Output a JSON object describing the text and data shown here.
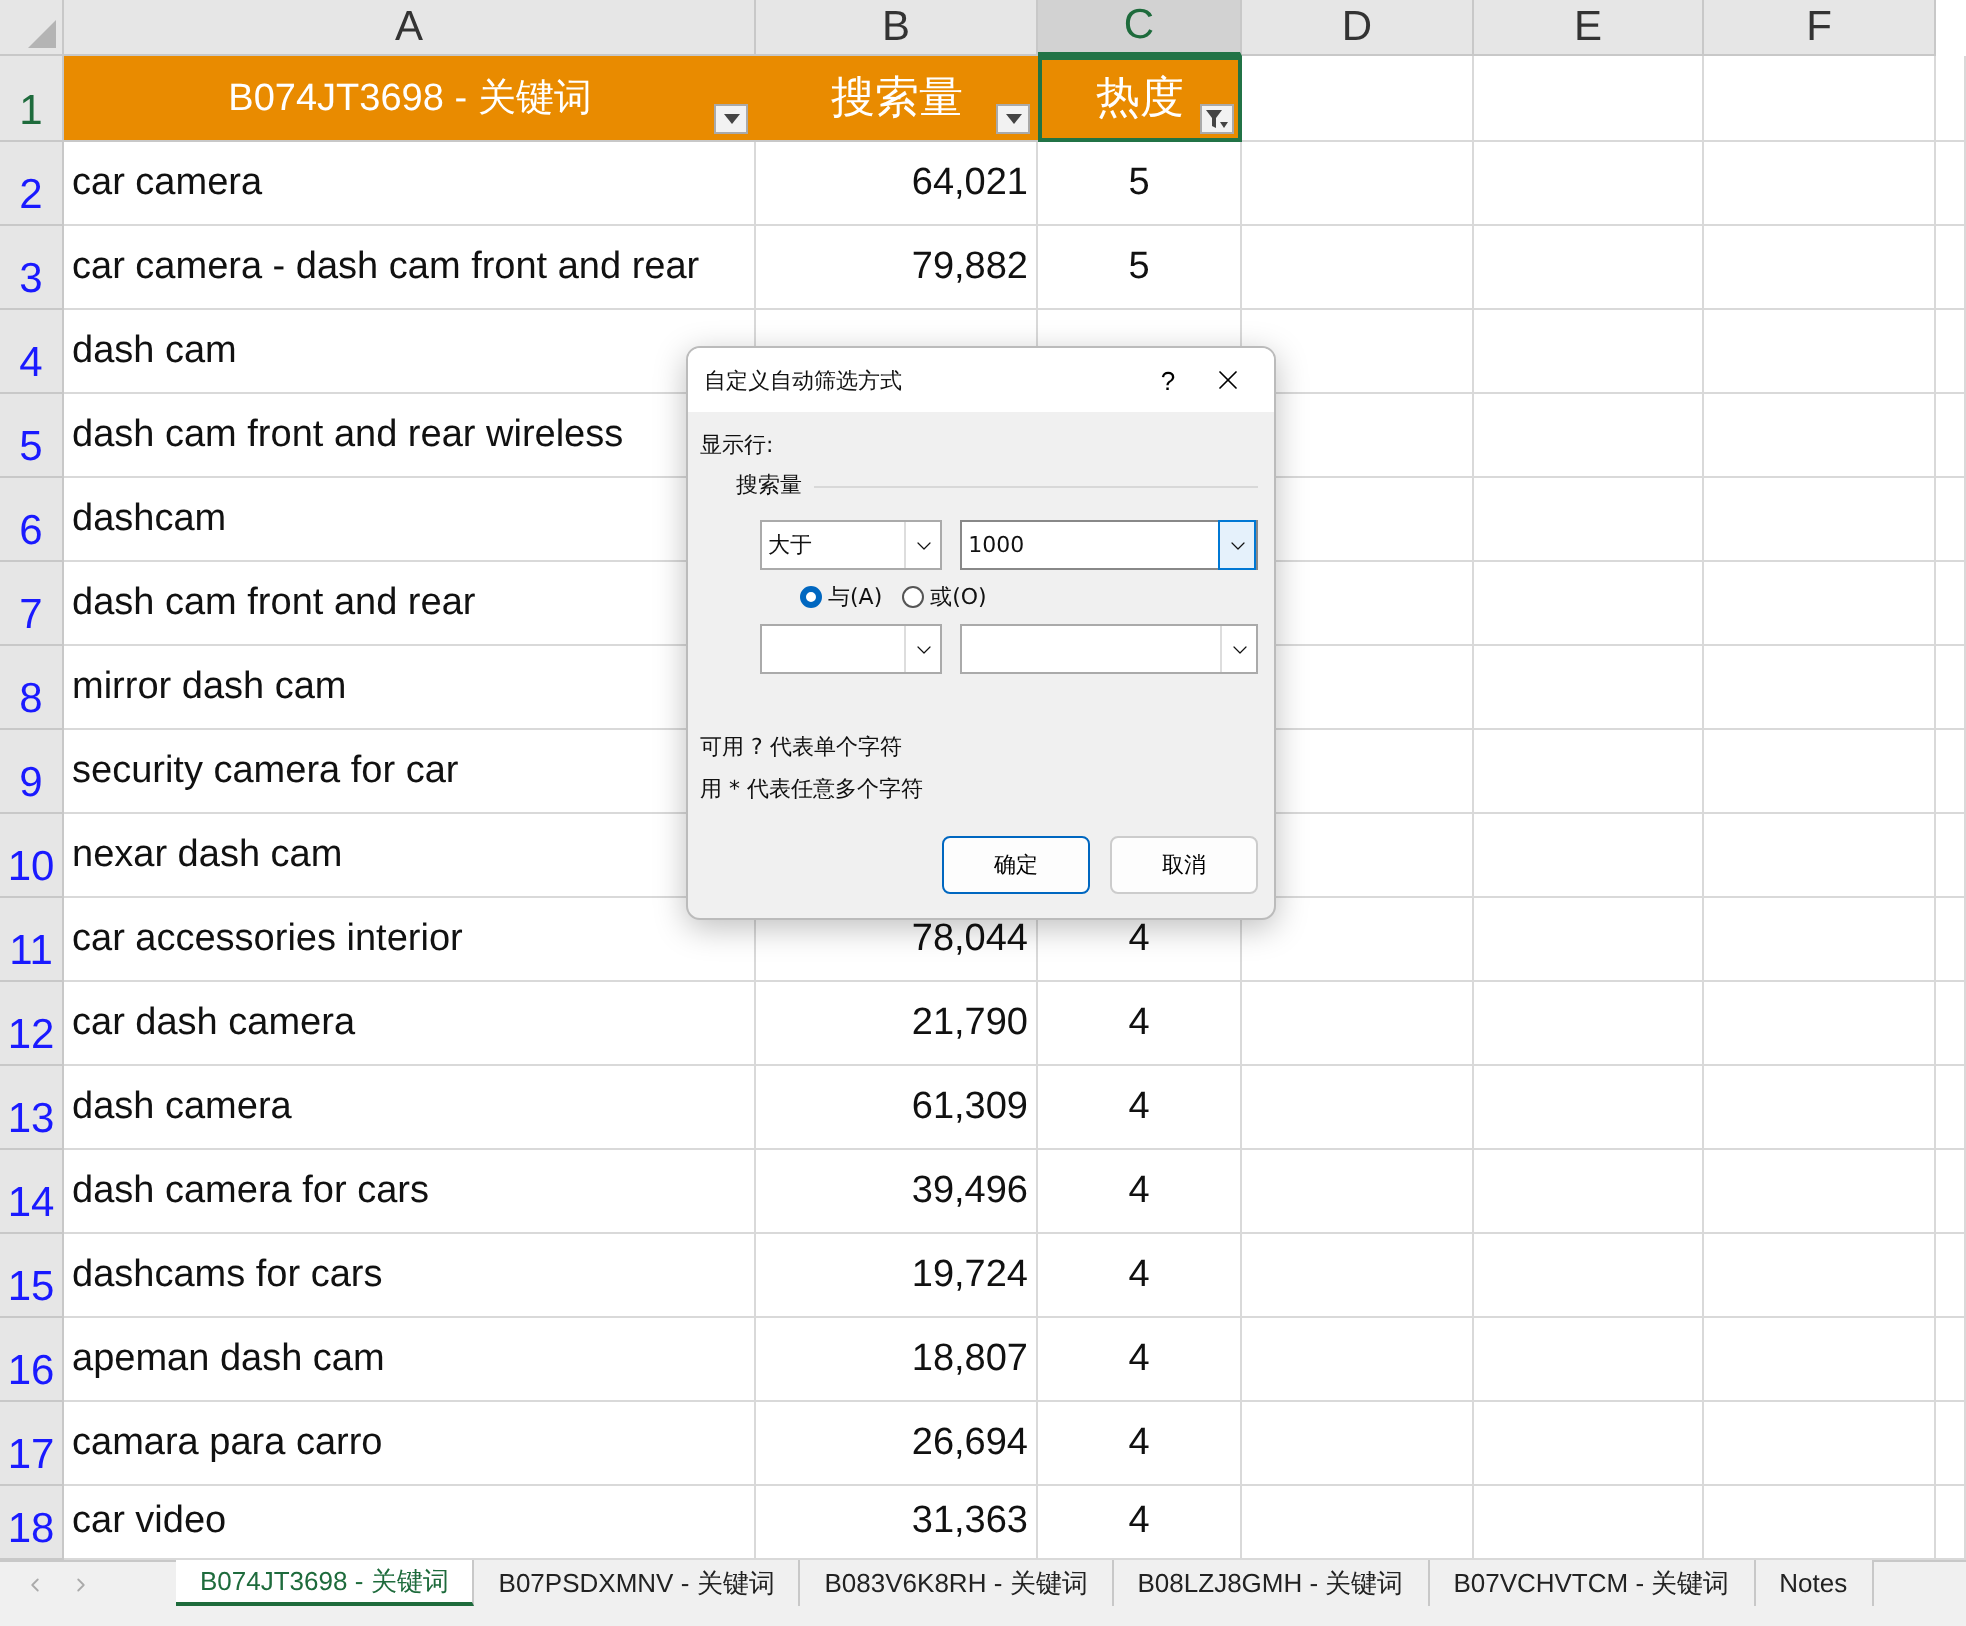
{
  "columns": [
    {
      "label": "A",
      "selected": false
    },
    {
      "label": "B",
      "selected": false
    },
    {
      "label": "C",
      "selected": true
    },
    {
      "label": "D",
      "selected": false
    },
    {
      "label": "E",
      "selected": false
    },
    {
      "label": "F",
      "selected": false
    }
  ],
  "header_row": {
    "number": "1",
    "cells": [
      {
        "text": "B074JT3698 - 关键词",
        "filtered": false
      },
      {
        "text": "搜索量",
        "filtered": false
      },
      {
        "text": "热度",
        "filtered": true
      }
    ]
  },
  "rows": [
    {
      "number": "2",
      "keyword": "car camera",
      "volume": "64,021",
      "heat": "5"
    },
    {
      "number": "3",
      "keyword": "car camera - dash cam front and rear",
      "volume": "79,882",
      "heat": "5"
    },
    {
      "number": "4",
      "keyword": "dash cam"
    },
    {
      "number": "5",
      "keyword": "dash cam front and rear wireless"
    },
    {
      "number": "6",
      "keyword": "dashcam"
    },
    {
      "number": "7",
      "keyword": "dash cam front and rear"
    },
    {
      "number": "8",
      "keyword": "mirror dash cam"
    },
    {
      "number": "9",
      "keyword": "security camera for car"
    },
    {
      "number": "10",
      "keyword": "nexar dash cam"
    },
    {
      "number": "11",
      "keyword": "car accessories interior",
      "volume": "78,044",
      "heat": "4"
    },
    {
      "number": "12",
      "keyword": "car dash camera",
      "volume": "21,790",
      "heat": "4"
    },
    {
      "number": "13",
      "keyword": "dash camera",
      "volume": "61,309",
      "heat": "4"
    },
    {
      "number": "14",
      "keyword": "dash camera for cars",
      "volume": "39,496",
      "heat": "4"
    },
    {
      "number": "15",
      "keyword": "dashcams for cars",
      "volume": "19,724",
      "heat": "4"
    },
    {
      "number": "16",
      "keyword": "apeman dash cam",
      "volume": "18,807",
      "heat": "4"
    },
    {
      "number": "17",
      "keyword": "camara para carro",
      "volume": "26,694",
      "heat": "4"
    },
    {
      "number": "18",
      "keyword": "car video",
      "volume": "31,363",
      "heat": "4"
    }
  ],
  "dialog": {
    "title": "自定义自动筛选方式",
    "help": "?",
    "section": "显示行:",
    "group": "搜索量",
    "conditions": [
      {
        "operator": "大于",
        "value": "1000",
        "focused": true
      },
      {
        "focused": false
      }
    ],
    "radios": [
      {
        "label": "与(A)",
        "selected": true
      },
      {
        "label": "或(O)",
        "selected": false
      }
    ],
    "hints": [
      "可用 ? 代表单个字符",
      "用 * 代表任意多个字符"
    ],
    "buttons": [
      {
        "label": "确定",
        "default": true
      },
      {
        "label": "取消",
        "default": false
      }
    ]
  },
  "sheet_tabs": [
    {
      "label": "B074JT3698 - 关键词",
      "selected": true
    },
    {
      "label": "B07PSDXMNV - 关键词",
      "selected": false
    },
    {
      "label": "B083V6K8RH - 关键词",
      "selected": false
    },
    {
      "label": "B08LZJ8GMH - 关键词",
      "selected": false
    },
    {
      "label": "B07VCHVTCM - 关键词",
      "selected": false
    },
    {
      "label": "Notes",
      "selected": false
    }
  ]
}
